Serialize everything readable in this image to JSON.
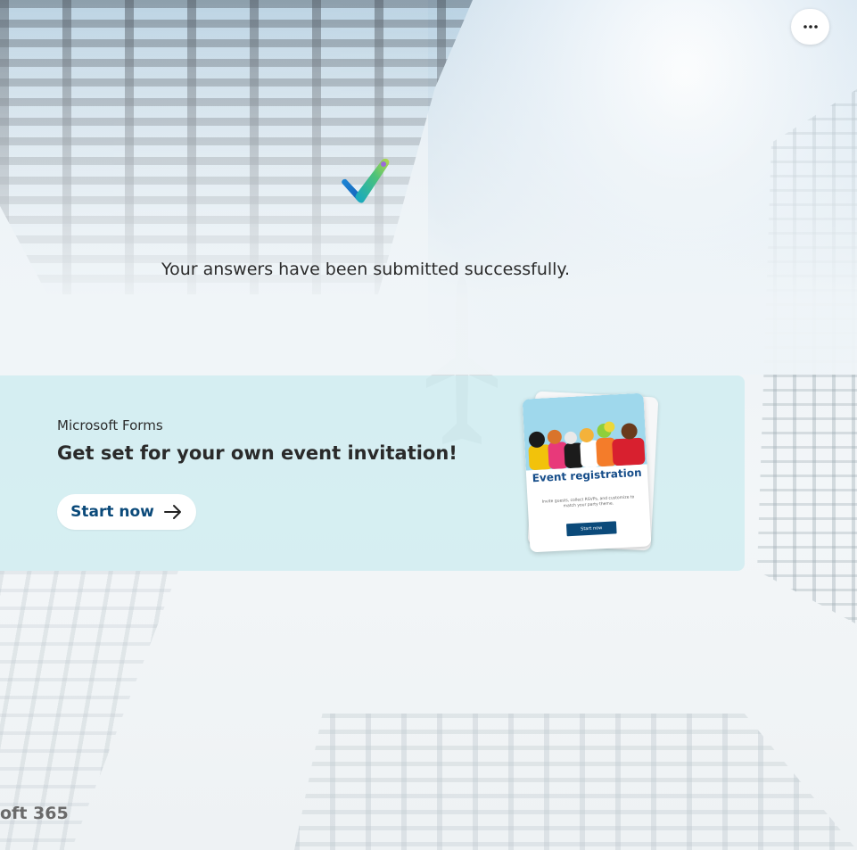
{
  "header": {
    "more_options_icon": "more-horizontal-icon"
  },
  "confirmation": {
    "icon": "checkmark-icon",
    "message": "Your answers have been submitted successfully."
  },
  "promo": {
    "subtitle": "Microsoft Forms",
    "title": "Get set for your own event invitation!",
    "button_label": "Start now",
    "button_icon": "arrow-right-icon",
    "card": {
      "title": "Event registration",
      "description": "Invite guests, collect RSVPs, and customize to match your party theme.",
      "button_label": "Start now"
    }
  },
  "footer": {
    "brand": "oft 365"
  },
  "colors": {
    "accent": "#0b4a7a",
    "banner": "#caecf0",
    "card_title": "#174e8a"
  }
}
